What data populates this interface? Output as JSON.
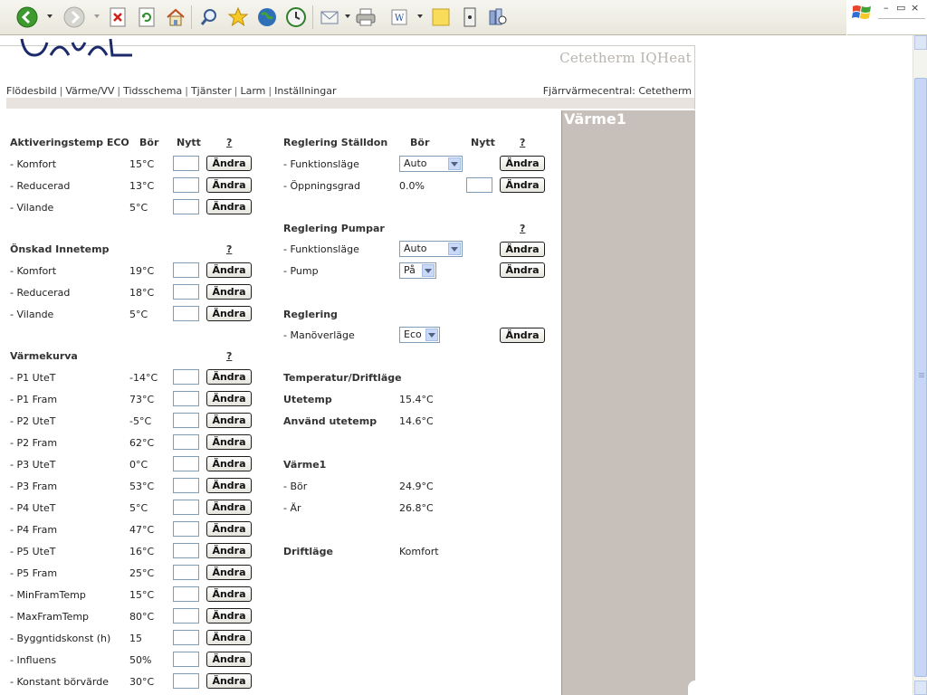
{
  "browser": {
    "toolbar_icons": [
      "back-icon",
      "forward-icon",
      "stop-icon",
      "refresh-icon",
      "home-icon",
      "search-icon",
      "favorites-icon",
      "media-icon",
      "history-icon",
      "mail-icon",
      "print-icon",
      "edit-icon",
      "discuss-icon",
      "messenger-icon",
      "research-icon"
    ],
    "window_controls": {
      "minimize": "–",
      "restore": "▭",
      "close": "×"
    }
  },
  "header": {
    "product_title": "Cetetherm IQHeat",
    "nav": [
      "Flödesbild",
      "Värme/VV",
      "Tidsschema",
      "Tjänster",
      "Larm",
      "Inställningar"
    ],
    "central": "Fjärrvärmecentral: Cetetherm"
  },
  "panel": {
    "title": "Värme1"
  },
  "labels": {
    "bor": "Bör",
    "nytt": "Nytt",
    "help": "?",
    "change": "Ändra"
  },
  "aktivering": {
    "title": "Aktiveringstemp ECO",
    "rows": [
      {
        "label": "- Komfort",
        "value": "15°C"
      },
      {
        "label": "- Reducerad",
        "value": "13°C"
      },
      {
        "label": "- Vilande",
        "value": "5°C"
      }
    ]
  },
  "innetemp": {
    "title": "Önskad Innetemp",
    "rows": [
      {
        "label": "- Komfort",
        "value": "19°C"
      },
      {
        "label": "- Reducerad",
        "value": "18°C"
      },
      {
        "label": "- Vilande",
        "value": "5°C"
      }
    ]
  },
  "varmekurva": {
    "title": "Värmekurva",
    "rows": [
      {
        "label": "- P1 UteT",
        "value": "-14°C"
      },
      {
        "label": "- P1 Fram",
        "value": "73°C"
      },
      {
        "label": "- P2 UteT",
        "value": "-5°C"
      },
      {
        "label": "- P2 Fram",
        "value": "62°C"
      },
      {
        "label": "- P3 UteT",
        "value": "0°C"
      },
      {
        "label": "- P3 Fram",
        "value": "53°C"
      },
      {
        "label": "- P4 UteT",
        "value": "5°C"
      },
      {
        "label": "- P4 Fram",
        "value": "47°C"
      },
      {
        "label": "- P5 UteT",
        "value": "16°C"
      },
      {
        "label": "- P5 Fram",
        "value": "25°C"
      },
      {
        "label": "- MinFramTemp",
        "value": "15°C"
      },
      {
        "label": "- MaxFramTemp",
        "value": "80°C"
      },
      {
        "label": "- Byggntidskonst (h)",
        "value": "15"
      },
      {
        "label": "- Influens",
        "value": "50%"
      },
      {
        "label": "- Konstant börvärde",
        "value": "30°C"
      }
    ]
  },
  "stalldon": {
    "title": "Reglering Ställdon",
    "funktion_label": "- Funktionsläge",
    "funktion_value": "Auto",
    "oppning_label": "- Öppningsgrad",
    "oppning_value": "0.0%"
  },
  "pumpar": {
    "title": "Reglering Pumpar",
    "funktion_label": "- Funktionsläge",
    "funktion_value": "Auto",
    "pump_label": "- Pump",
    "pump_value": "På"
  },
  "reglering": {
    "title": "Reglering",
    "manover_label": "- Manöverläge",
    "manover_value": "Eco"
  },
  "temperatur": {
    "title": "Temperatur/Driftläge",
    "utetemp_label": "Utetemp",
    "utetemp_value": "15.4°C",
    "anvand_label": "Använd utetemp",
    "anvand_value": "14.6°C"
  },
  "varme1": {
    "title": "Värme1",
    "bor_label": "- Bör",
    "bor_value": "24.9°C",
    "ar_label": "- Är",
    "ar_value": "26.8°C"
  },
  "driftlage": {
    "label": "Driftläge",
    "value": "Komfort"
  },
  "colors": {
    "panel": "#c7bfb9",
    "strip": "#e8e3df",
    "title_gray": "#b8b3ad",
    "logo_navy": "#1b2a6b"
  }
}
